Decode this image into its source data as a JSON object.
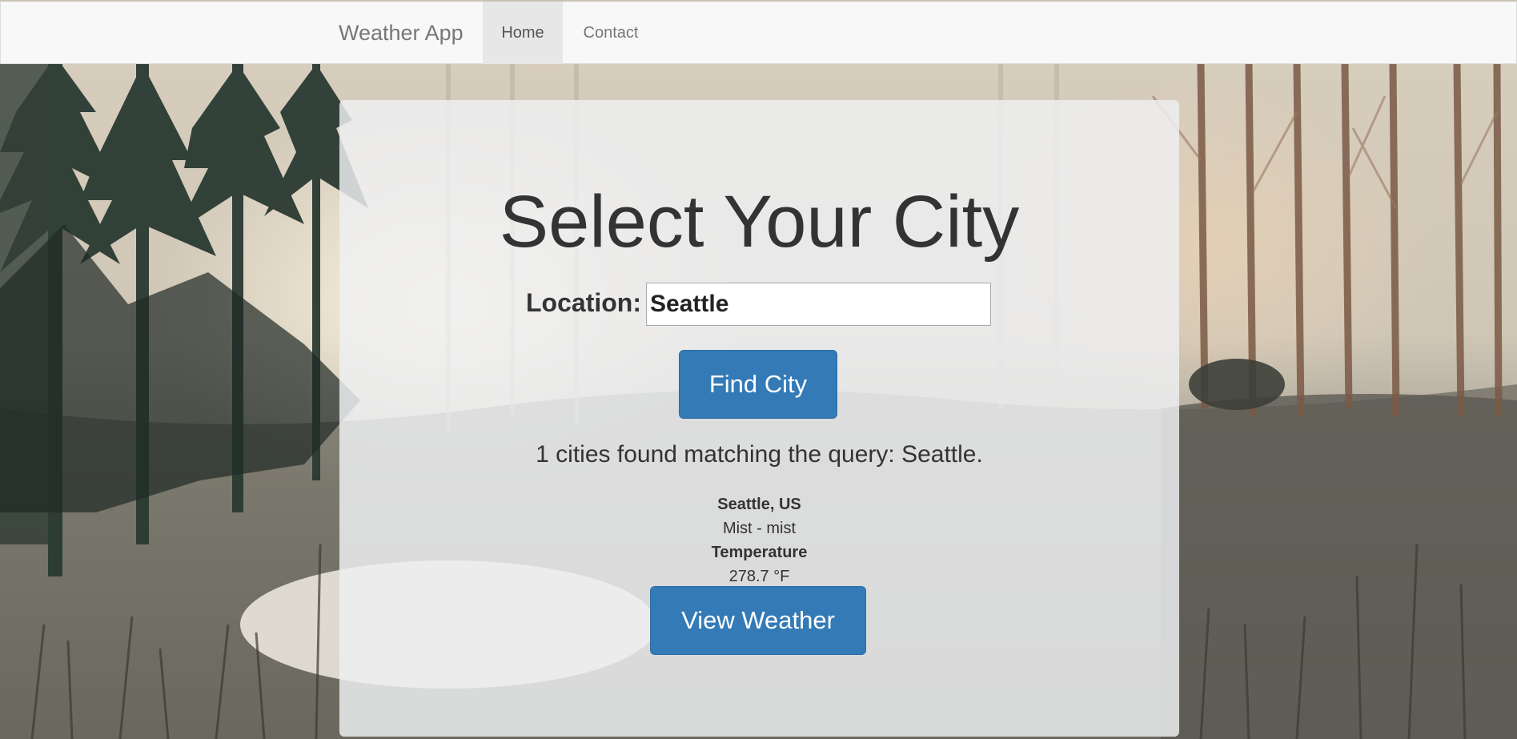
{
  "navbar": {
    "brand": "Weather App",
    "items": [
      {
        "label": "Home",
        "active": true
      },
      {
        "label": "Contact",
        "active": false
      }
    ]
  },
  "main": {
    "title": "Select Your City",
    "location_label": "Location:",
    "location_value": "Seattle",
    "find_button": "Find City",
    "result_message": "1 cities found matching the query: Seattle.",
    "result": {
      "city": "Seattle, US",
      "condition": "Mist - mist",
      "temperature_label": "Temperature",
      "temperature_value": "278.7 °F"
    },
    "view_button": "View Weather"
  },
  "colors": {
    "primary_button": "#337ab7",
    "navbar_bg": "#f8f8f8",
    "active_nav_bg": "#e7e7e7"
  }
}
